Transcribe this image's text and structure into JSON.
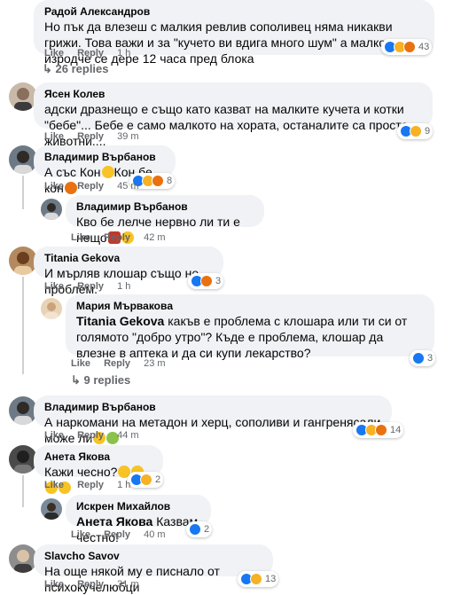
{
  "ui": {
    "like": "Like",
    "reply": "Reply"
  },
  "colors": {
    "bubble": "#f0f2f5",
    "meta": "#65676b",
    "like": "#1877f2",
    "haha": "#f7b125",
    "angry": "#e9710f"
  },
  "c1": {
    "author": "Радой Александров",
    "text": "Но пък да влезеш с малкия ревлив сополивец няма никакви грижи. Това важи и за \"кучето ви вдига много шум\" а малкото изродче се дере 12 часа пред блока",
    "time": "1 h",
    "react_count": "43",
    "replies": "26 replies"
  },
  "c2": {
    "author": "Ясен Колев",
    "text": "адски дразнещо е също като казват на малките кучета и котки \"бебе\"... Бебе е само малкото на хората, останалите са просто животни....",
    "time": "39 m",
    "react_count": "9"
  },
  "c3": {
    "author": "Владимир Върбанов",
    "text_a": "А със Кон",
    "text_b": "Кон бе кон",
    "time": "45 m",
    "react_count": "8"
  },
  "c3r": {
    "author": "Владимир Върбанов",
    "text": "Кво бе лелче нервно ли ти е нещо",
    "time": "42 m"
  },
  "c4": {
    "author": "Titania Gekova",
    "text": "И мърляв клошар също не проблем.",
    "time": "1 h",
    "react_count": "3"
  },
  "c4r": {
    "author": "Мария Мърваковa",
    "mention": "Titania Gekova",
    "text": " какъв е проблема с клошара или ти си от голямото \"добро утро\"? Къде е проблема, клошар да влезне в аптека и да си купи лекарство?",
    "time": "23 m",
    "react_count": "3",
    "replies": "9 replies"
  },
  "c5": {
    "author": "Владимир Върбанов",
    "text": "А наркомани на метадон и херц, сополиви и гангренясали може ли",
    "time": "44 m",
    "react_count": "14"
  },
  "c6": {
    "author": "Анета Якова",
    "text": "Кажи чесно?",
    "time": "1 h",
    "react_count": "2"
  },
  "c6r": {
    "author": "Искрен Михайлов",
    "mention": "Анета Якова",
    "text": " Казвам честно!",
    "time": "40 m",
    "react_count": "2"
  },
  "c7": {
    "author": "Slavcho Savov",
    "text": "На още някой му е писнало от психокучелюбци",
    "time": "31 m",
    "react_count": "13"
  }
}
